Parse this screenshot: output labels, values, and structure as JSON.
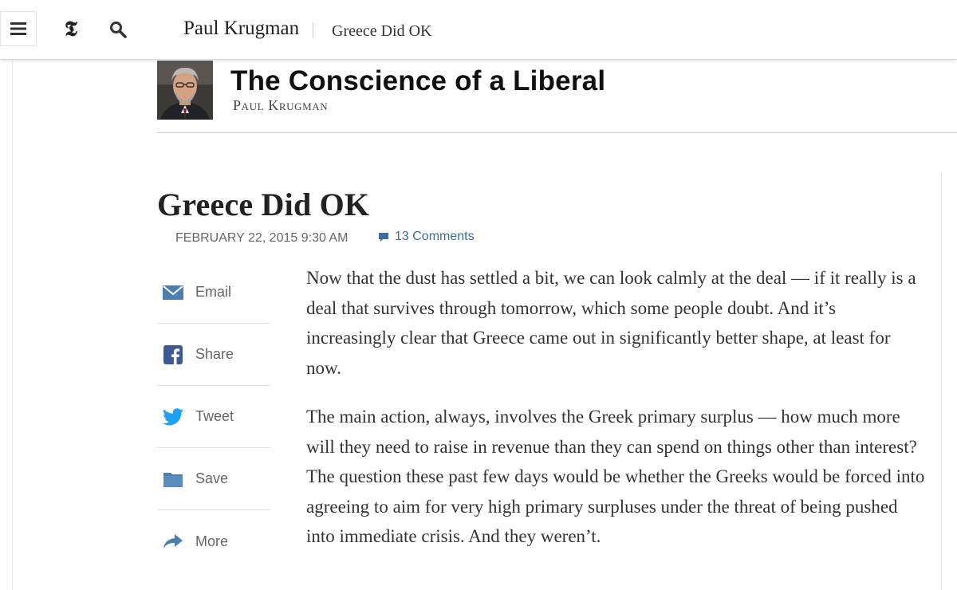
{
  "header": {
    "author": "Paul Krugman",
    "story_title": "Greece Did OK"
  },
  "blog": {
    "title": "The Conscience of a Liberal",
    "author": "Paul Krugman",
    "avatar": "author-photo"
  },
  "article": {
    "headline": "Greece Did OK",
    "dateline": "FEBRUARY 22, 2015 9:30 AM",
    "comments_label": "13 Comments",
    "paragraphs": [
      "Now that the dust has settled a bit, we can look calmly at the deal — if it really is a deal that survives through tomorrow, which some people doubt. And it’s increasingly clear that Greece came out in significantly better shape, at least for now.",
      "The main action, always, involves the Greek primary surplus — how much more will they need to raise in revenue than they can spend on things other than interest? The question these past few days would be whether the Greeks would be forced into agreeing to aim for very high primary surpluses under the threat of being pushed into immediate crisis. And they weren’t."
    ]
  },
  "share_tools": [
    {
      "label": "Email",
      "icon": "email-icon"
    },
    {
      "label": "Share",
      "icon": "facebook-icon"
    },
    {
      "label": "Tweet",
      "icon": "twitter-icon"
    },
    {
      "label": "Save",
      "icon": "folder-icon"
    },
    {
      "label": "More",
      "icon": "arrow-more-icon"
    }
  ],
  "colors": {
    "link_blue": "#3b6d9e",
    "icon_blue": "#4b7fb3",
    "facebook_blue": "#3b5998",
    "twitter_blue": "#1da1f2"
  }
}
